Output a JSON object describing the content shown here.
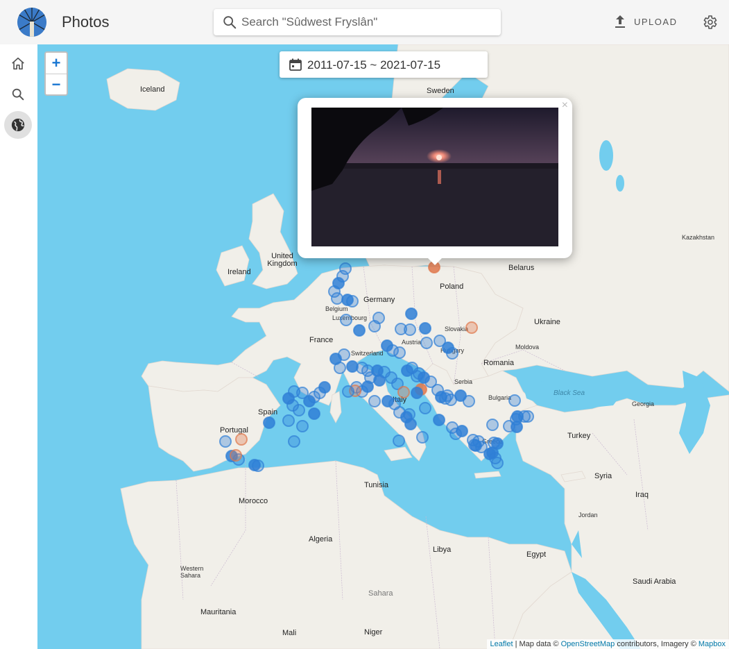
{
  "header": {
    "app_title": "Photos",
    "search_placeholder": "Search \"Sûdwest Fryslân\"",
    "upload_label": "UPLOAD"
  },
  "sidebar": {
    "items": [
      {
        "name": "home",
        "icon": "home-icon",
        "active": false
      },
      {
        "name": "search",
        "icon": "search-icon",
        "active": false
      },
      {
        "name": "map",
        "icon": "globe-icon",
        "active": true
      }
    ]
  },
  "map": {
    "date_range": "2011-07-15 ~ 2021-07-15",
    "zoom_in": "+",
    "zoom_out": "−",
    "popup_close": "×",
    "attribution": {
      "leaflet": "Leaflet",
      "sep1": " | Map data © ",
      "osm": "OpenStreetMap",
      "mid": " contributors, Imagery © ",
      "mapbox": "Mapbox"
    },
    "labels": {
      "iceland": "Iceland",
      "sweden": "Sweden",
      "ireland": "Ireland",
      "uk": "United Kingdom",
      "belarus": "Belarus",
      "poland": "Poland",
      "germany": "Germany",
      "ukraine": "Ukraine",
      "france": "France",
      "romania": "Romania",
      "spain": "Spain",
      "italy": "Italy",
      "portugal": "Portugal",
      "turkey": "Turkey",
      "syria": "Syria",
      "iraq": "Iraq",
      "tunisia": "Tunisia",
      "morocco": "Morocco",
      "algeria": "Algeria",
      "libya": "Libya",
      "egypt": "Egypt",
      "saudi": "Saudi Arabia",
      "mauritania": "Mauritania",
      "mali": "Mali",
      "niger": "Niger",
      "sahara": "Sahara",
      "black_sea": "Black Sea",
      "georgia": "Georgia",
      "hungary": "Hungary",
      "austria": "Austria",
      "greece": "Greece",
      "bulgaria": "Bulgaria",
      "serbia": "Serbia",
      "moldova": "Moldova",
      "western_sahara": "Western Sahara",
      "jordan": "Jordan",
      "kazakhstan": "Kazakhstan",
      "belgium": "Belgium",
      "switzerland": "Switzerland",
      "slovakia": "Slovakia",
      "luxembourg": "Luxembourg"
    }
  },
  "colors": {
    "marker_blue": "#2f7fd6",
    "marker_orange": "#e0784c",
    "water": "#72cdee",
    "land": "#f1efe9",
    "accent": "#1976d2"
  }
}
